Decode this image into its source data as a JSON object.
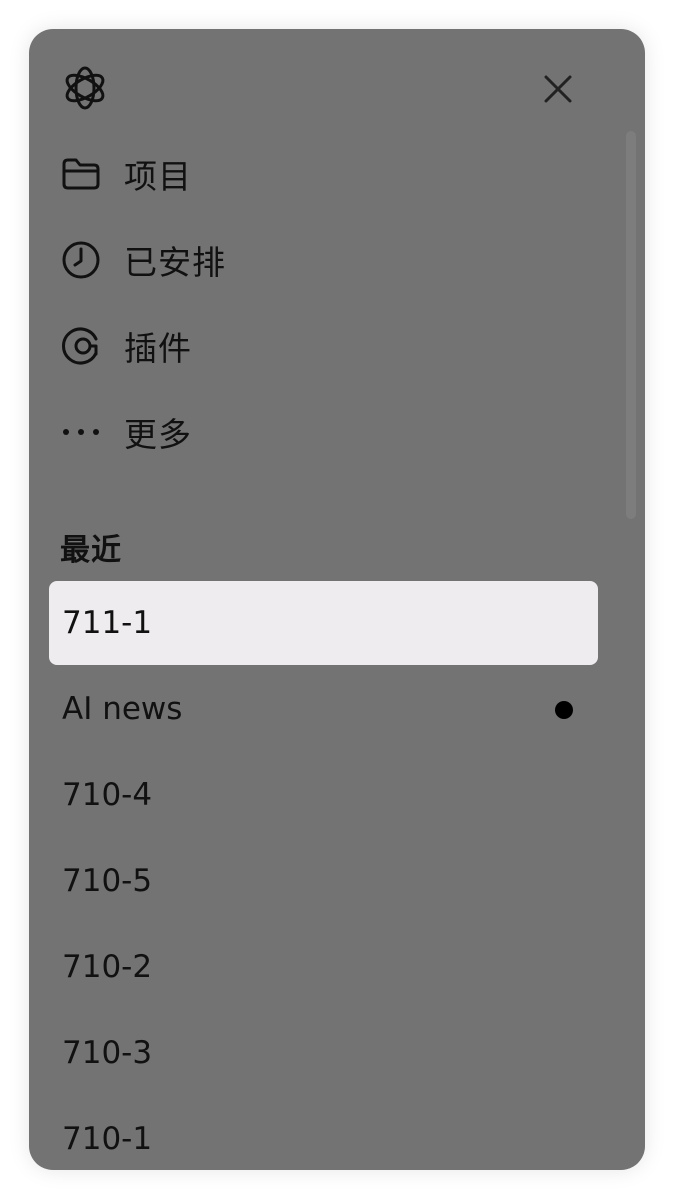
{
  "nav": {
    "items": [
      {
        "label": "项目",
        "icon": "folder-icon"
      },
      {
        "label": "已安排",
        "icon": "clock-icon"
      },
      {
        "label": "插件",
        "icon": "plugin-icon"
      },
      {
        "label": "更多",
        "icon": "more-icon"
      }
    ]
  },
  "recent": {
    "title": "最近",
    "items": [
      {
        "label": "711-1",
        "selected": true
      },
      {
        "label": "AI news",
        "unread": true
      },
      {
        "label": "710-4"
      },
      {
        "label": "710-5"
      },
      {
        "label": "710-2"
      },
      {
        "label": "710-3"
      },
      {
        "label": "710-1"
      }
    ]
  },
  "colors": {
    "panel": "#737373",
    "selected": "#efecef",
    "text": "#111111"
  }
}
